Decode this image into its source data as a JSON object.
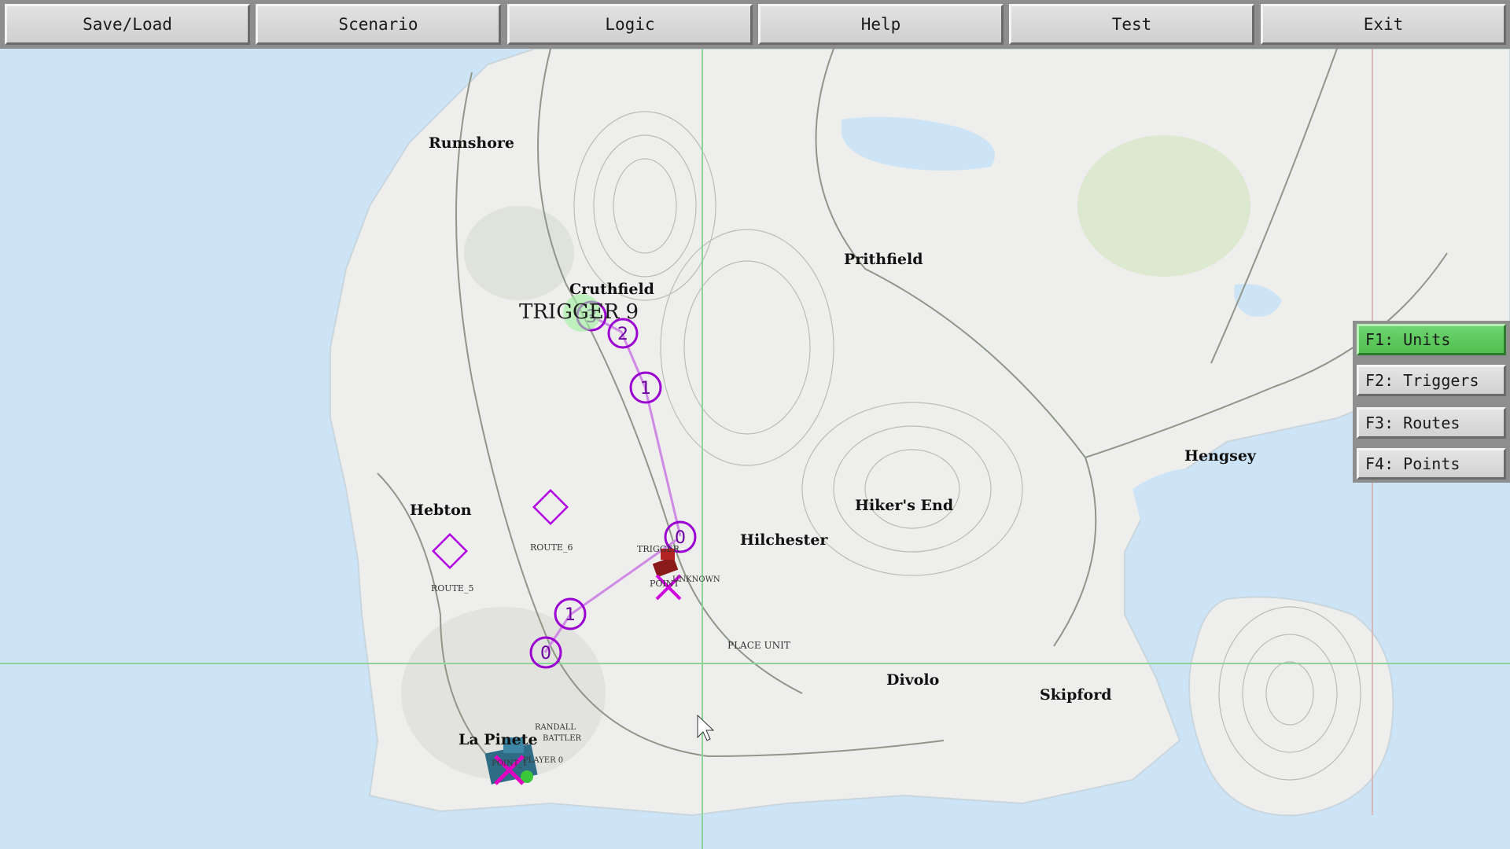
{
  "menu": {
    "save_load": "Save/Load",
    "scenario": "Scenario",
    "logic": "Logic",
    "help": "Help",
    "test": "Test",
    "exit": "Exit"
  },
  "side_panel": {
    "units": "F1: Units",
    "triggers": "F2: Triggers",
    "routes": "F3: Routes",
    "points": "F4: Points",
    "active": "F1: Units"
  },
  "map": {
    "places": {
      "rumshore": "Rumshore",
      "cruthfield": "Cruthfield",
      "prithfield": "Prithfield",
      "hebton": "Hebton",
      "hikers_end": "Hiker's End",
      "hilchester": "Hilchester",
      "hengsey": "Hengsey",
      "divolo": "Divolo",
      "skipford": "Skipford",
      "la_pinete": "La Pinete"
    },
    "trigger_label": "TRIGGER 9",
    "route_5": "ROUTE_5",
    "route_6": "ROUTE_6",
    "place_unit": "PLACE UNIT",
    "small_labels": {
      "trigger": "TRIGGER",
      "point": "POINT",
      "unknown": "UNKNOWN",
      "randall": "RANDALL",
      "battler": "BATTLER",
      "point_1": "POINT_1",
      "player_0": "PLAYER 0"
    },
    "waypoints": {
      "a0": "0",
      "a1": "1",
      "b1": "1",
      "b2": "2",
      "b3": "3",
      "c0": "0"
    }
  },
  "colors": {
    "water": "#cde4f7",
    "land": "#eeeeec",
    "route": "#b000e0",
    "route_line": "#cf8ae6",
    "grid": "#8cd49a",
    "active_tab": "#5cc95c"
  }
}
